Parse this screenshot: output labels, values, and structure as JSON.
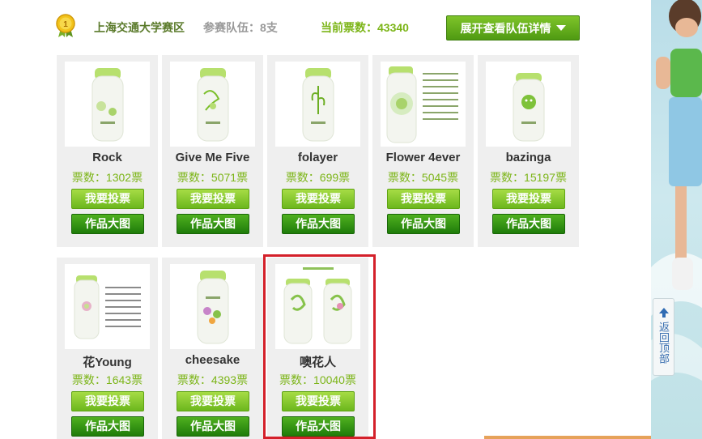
{
  "header": {
    "region": "上海交通大学赛区",
    "teams_label": "参赛队伍：",
    "teams_value": "8支",
    "total_votes": "当前票数：43340",
    "expand_label": "展开查看队伍详情"
  },
  "cards": [
    {
      "name": "Rock",
      "votes": "票数：1302票",
      "vote_label": "我要投票",
      "big_label": "作品大图"
    },
    {
      "name": "Give Me Five",
      "votes": "票数：5071票",
      "vote_label": "我要投票",
      "big_label": "作品大图"
    },
    {
      "name": "folayer",
      "votes": "票数：699票",
      "vote_label": "我要投票",
      "big_label": "作品大图"
    },
    {
      "name": "Flower 4ever",
      "votes": "票数：5045票",
      "vote_label": "我要投票",
      "big_label": "作品大图"
    },
    {
      "name": "bazinga",
      "votes": "票数：15197票",
      "vote_label": "我要投票",
      "big_label": "作品大图"
    },
    {
      "name": "花Young",
      "votes": "票数：1643票",
      "vote_label": "我要投票",
      "big_label": "作品大图"
    },
    {
      "name": "cheesake",
      "votes": "票数：4393票",
      "vote_label": "我要投票",
      "big_label": "作品大图"
    },
    {
      "name": "噢花人",
      "votes": "票数：10040票",
      "vote_label": "我要投票",
      "big_label": "作品大图"
    }
  ],
  "back_to_top": "返回顶部",
  "colors": {
    "accent_green": "#7cb518",
    "vote_button": "#8ccd2e",
    "big_button": "#2f9416",
    "highlight": "#d4202a"
  }
}
